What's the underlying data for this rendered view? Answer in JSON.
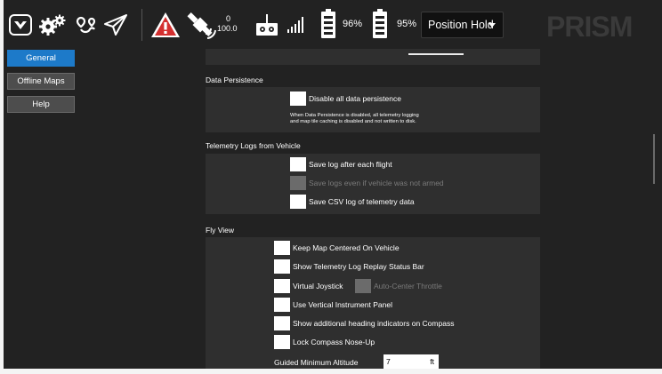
{
  "toolbar": {
    "gps": {
      "satellite_count": "0",
      "hdop": "100.0"
    },
    "battery1": {
      "percent": "96%"
    },
    "battery2": {
      "percent": "95%"
    },
    "flight_mode": {
      "selected": "Position Hold"
    },
    "brand": "PRISM",
    "icons": {
      "app_logo": "app-logo-icon",
      "settings": "gears-icon",
      "plan": "plan-route-icon",
      "fly": "paper-plane-icon",
      "warning": "warning-triangle-icon",
      "gps": "satellite-icon",
      "rc": "radio-controller-icon",
      "rssi": "signal-bars-icon",
      "battery": "battery-icon"
    },
    "colors": {
      "warning": "#d32f2f",
      "background": "#222222"
    }
  },
  "sidebar": {
    "items": [
      {
        "label": "General",
        "active": true
      },
      {
        "label": "Offline Maps",
        "active": false
      },
      {
        "label": "Help",
        "active": false
      }
    ],
    "accent": "#1d7ac9"
  },
  "sections": {
    "data_persistence": {
      "title": "Data Persistence",
      "disable_label": "Disable all data persistence",
      "note_line1": "When Data Persistence is disabled, all telemetry logging",
      "note_line2": "and map tile caching is disabled and not written to disk."
    },
    "telemetry_logs": {
      "title": "Telemetry Logs from Vehicle",
      "options": [
        "Save log after each flight",
        "Save logs even if vehicle was not armed",
        "Save CSV log of telemetry data"
      ]
    },
    "fly_view": {
      "title": "Fly View",
      "options": {
        "keep_map_centered": "Keep Map Centered On Vehicle",
        "replay_status_bar": "Show Telemetry Log Replay Status Bar",
        "virtual_joystick": "Virtual Joystick",
        "auto_center_throttle": "Auto-Center Throttle",
        "vertical_instrument_panel": "Use Vertical Instrument Panel",
        "heading_indicators": "Show additional heading indicators on Compass",
        "lock_compass": "Lock Compass Nose-Up"
      },
      "guided_min_altitude": {
        "label": "Guided Minimum Altitude",
        "value": "7",
        "unit": "ft"
      }
    }
  }
}
